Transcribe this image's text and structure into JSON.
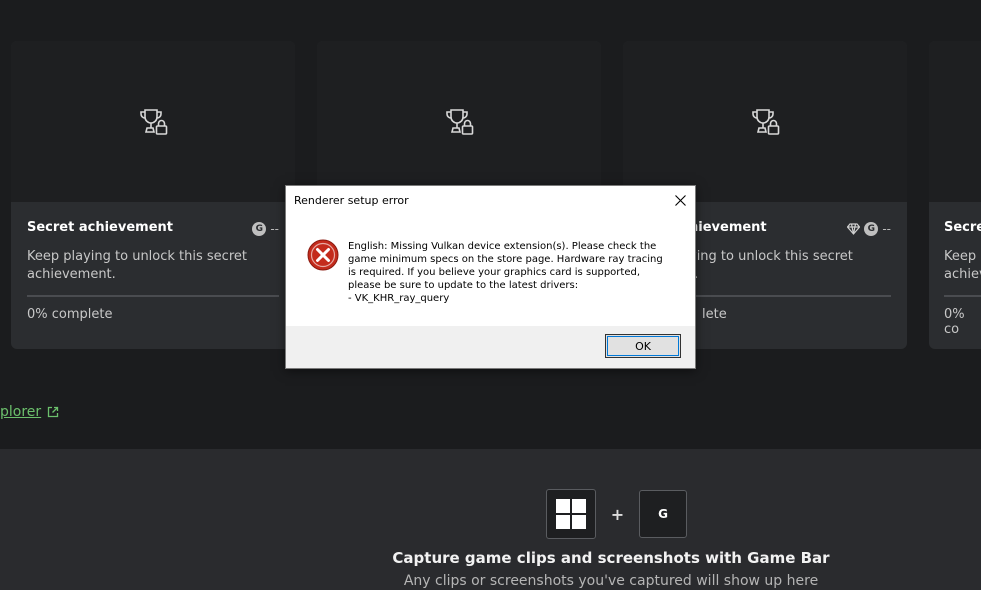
{
  "cards": [
    {
      "title": "Secret achievement",
      "description": "Keep playing to unlock this secret achievement.",
      "gamerscore": "--",
      "gbadge": "G",
      "progress": "0% complete"
    },
    {
      "title": "",
      "description": "",
      "gamerscore": "",
      "gbadge": "",
      "progress": ""
    },
    {
      "title": "hievement",
      "description": "ying to unlock this secret\nt.",
      "gamerscore": "--",
      "gbadge": "G",
      "progress": "lete"
    },
    {
      "title": "Secre",
      "description": "Keep\nachiev",
      "gamerscore": "",
      "gbadge": "",
      "progress": "0% co"
    }
  ],
  "explorer_link": "plorer",
  "gamebar": {
    "key_g": "G",
    "plus": "+",
    "title": "Capture game clips and screenshots with Game Bar",
    "subtitle": "Any clips or screenshots you've captured will show up here"
  },
  "dialog": {
    "title": "Renderer setup error",
    "message": "English: Missing Vulkan device extension(s). Please check the\ngame minimum specs on the store page. Hardware ray tracing\nis required. If you believe your graphics card is supported,\nplease be sure to update to the latest drivers:\n- VK_KHR_ray_query",
    "ok_label": "OK"
  },
  "icons": {
    "achievement": "trophy-lock-icon",
    "rarity": "diamond-icon",
    "close": "close-icon",
    "error": "error-icon",
    "windows_key": "windows-logo-icon",
    "external": "external-link-icon"
  }
}
